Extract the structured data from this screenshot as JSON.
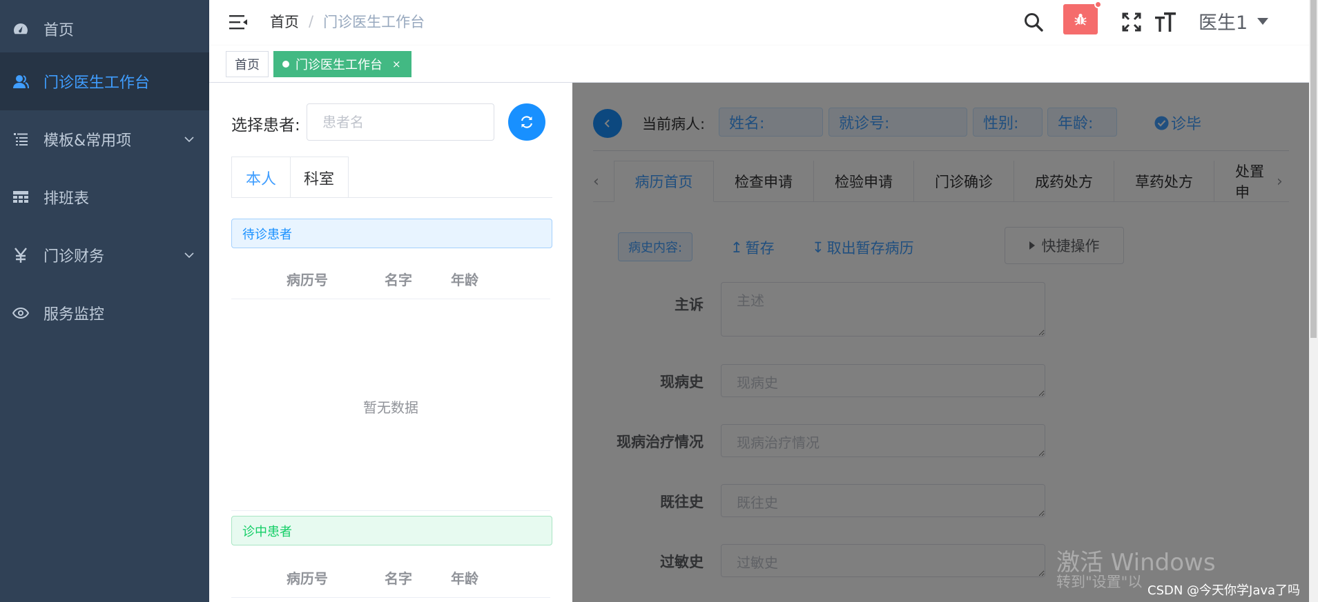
{
  "sidebar": {
    "items": [
      {
        "label": "首页",
        "icon": "dashboard-icon"
      },
      {
        "label": "门诊医生工作台",
        "icon": "user-icon",
        "active": true
      },
      {
        "label": "模板&常用项",
        "icon": "list-icon",
        "has_children": true
      },
      {
        "label": "排班表",
        "icon": "table-icon"
      },
      {
        "label": "门诊财务",
        "icon": "yen-icon",
        "has_children": true
      },
      {
        "label": "服务监控",
        "icon": "eye-icon"
      }
    ]
  },
  "navbar": {
    "breadcrumb": {
      "home": "首页",
      "separator": "/",
      "current": "门诊医生工作台"
    },
    "user_name": "医生1"
  },
  "tags": {
    "home": "首页",
    "active": "门诊医生工作台",
    "close": "×"
  },
  "left_panel": {
    "select_label": "选择患者:",
    "search_placeholder": "患者名",
    "tabs": [
      "本人",
      "科室"
    ],
    "waiting_title": "待诊患者",
    "in_progress_title": "诊中患者",
    "columns": [
      "病历号",
      "名字",
      "年龄"
    ],
    "empty_text": "暂无数据"
  },
  "right_panel": {
    "current_label": "当前病人:",
    "name_label": "姓名:",
    "visit_no_label": "就诊号:",
    "gender_label": "性别:",
    "age_label": "年龄:",
    "done_label": "诊毕",
    "tabs": [
      "病历首页",
      "检查申请",
      "检验申请",
      "门诊确诊",
      "成药处方",
      "草药处方",
      "处置申"
    ],
    "history_tag": "病史内容:",
    "save_draft": "暂存",
    "load_draft": "取出暂存病历",
    "quick_ops": "快捷操作",
    "fields": [
      {
        "label": "主诉",
        "placeholder": "主述"
      },
      {
        "label": "现病史",
        "placeholder": "现病史"
      },
      {
        "label": "现病治疗情况",
        "placeholder": "现病治疗情况"
      },
      {
        "label": "既往史",
        "placeholder": "既往史"
      },
      {
        "label": "过敏史",
        "placeholder": "过敏史"
      }
    ]
  },
  "overlay_text": {
    "windows_title": "激活 Windows",
    "windows_sub": "转到\"设置\"以",
    "csdn": "CSDN @今天你学Java了吗"
  },
  "colors": {
    "sidebar_bg": "#304156",
    "accent": "#409eff",
    "tag_active": "#42b983",
    "bug_button": "#f56c6c"
  }
}
